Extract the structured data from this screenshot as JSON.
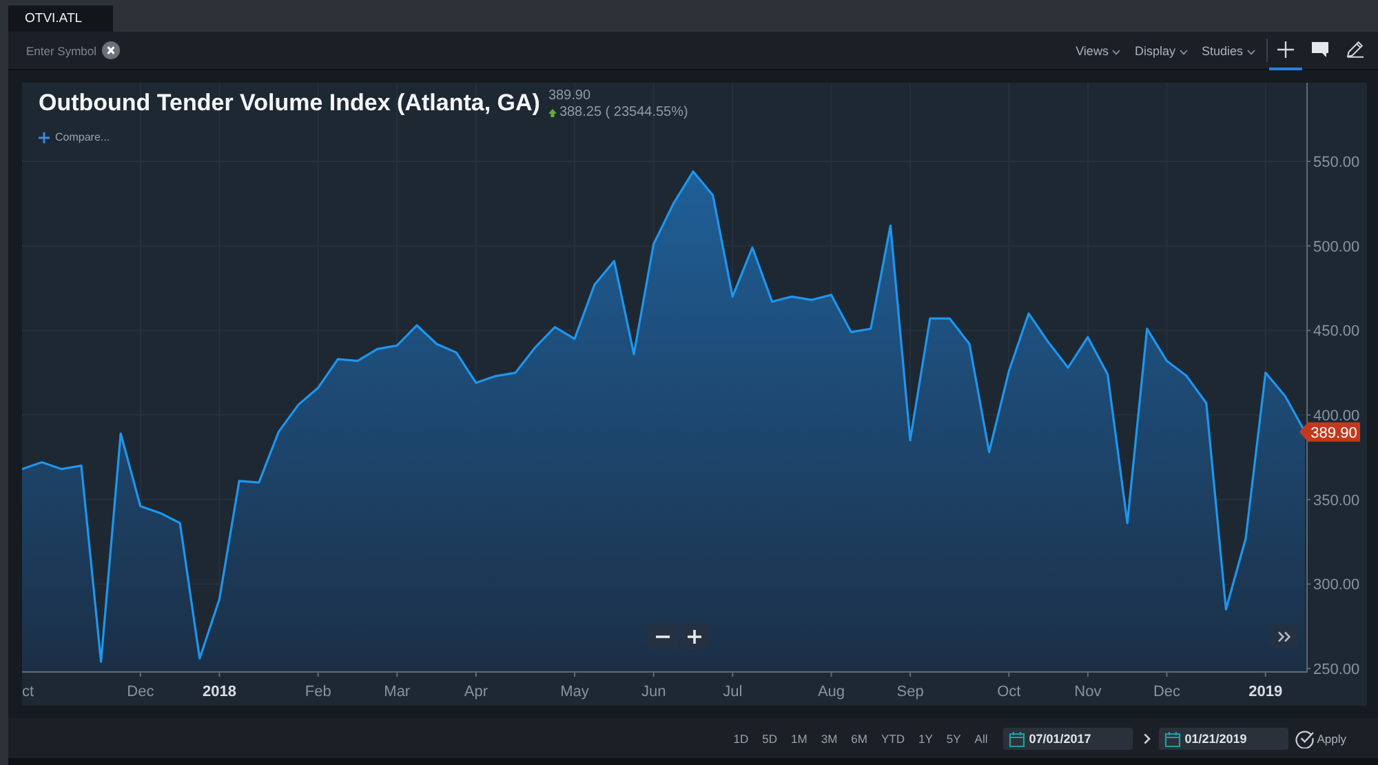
{
  "tabs": [
    {
      "label": "OTVI.ATL",
      "selected": true
    }
  ],
  "toolbar": {
    "symbol_field": {
      "placeholder": "Enter Symbol"
    },
    "menus": [
      "Views",
      "Display",
      "Studies"
    ],
    "tools": [
      {
        "kind": "crosshair",
        "selected": true
      },
      {
        "kind": "comment",
        "selected": false
      },
      {
        "kind": "draw",
        "selected": false
      }
    ]
  },
  "chart": {
    "title": "Outbound Tender Volume Index (Atlanta, GA)",
    "price": "389.90",
    "change": {
      "rising": true,
      "text": "388.25 ( 23544.55%)"
    },
    "compare_label": "Compare...",
    "chart_data": {
      "type": "area",
      "grid": true,
      "categories": [
        "ct",
        null,
        null,
        null,
        null,
        null,
        "Dec",
        null,
        null,
        null,
        "2018",
        null,
        null,
        null,
        null,
        "Feb",
        null,
        null,
        null,
        "Mar",
        null,
        null,
        null,
        "Apr",
        null,
        null,
        null,
        null,
        "May",
        null,
        null,
        null,
        "Jun",
        null,
        null,
        null,
        "Jul",
        null,
        null,
        null,
        null,
        "Aug",
        null,
        null,
        null,
        "Sep",
        null,
        null,
        null,
        null,
        "Oct",
        null,
        null,
        null,
        "Nov",
        null,
        null,
        null,
        "Dec",
        null,
        null,
        null,
        null,
        "2019",
        null,
        null
      ],
      "values": [
        368,
        372,
        368,
        370,
        254,
        389,
        346,
        342,
        336,
        256,
        291,
        361,
        360,
        390,
        406,
        416,
        433,
        432,
        439,
        441,
        453,
        442,
        437,
        419,
        423,
        425,
        440,
        452,
        445,
        477,
        491,
        436,
        501,
        525,
        544,
        530,
        470,
        499,
        467,
        470,
        468,
        471,
        449,
        451,
        512,
        385,
        457,
        457,
        442,
        378,
        426,
        460,
        443,
        428,
        446,
        424,
        336,
        451,
        432,
        423,
        407,
        285,
        327,
        425,
        411,
        389.9
      ],
      "ylim": [
        248.4,
        596.5
      ],
      "yticks": [
        {
          "value": 250,
          "label": "250.00"
        },
        {
          "value": 300,
          "label": "300.00"
        },
        {
          "value": 350,
          "label": "350.00"
        },
        {
          "value": 400,
          "label": "400.00"
        },
        {
          "value": 450,
          "label": "450.00"
        },
        {
          "value": 500,
          "label": "500.00"
        },
        {
          "value": 550,
          "label": "550.00"
        }
      ],
      "annotations": [
        "389.90"
      ]
    }
  },
  "footer": {
    "ranges": [
      "1D",
      "5D",
      "1M",
      "3M",
      "6M",
      "YTD",
      "1Y",
      "5Y",
      "All"
    ],
    "start_date": {
      "value": "07/01/2017"
    },
    "end_date": {
      "value": "01/21/2019"
    },
    "apply_label": "Apply"
  }
}
